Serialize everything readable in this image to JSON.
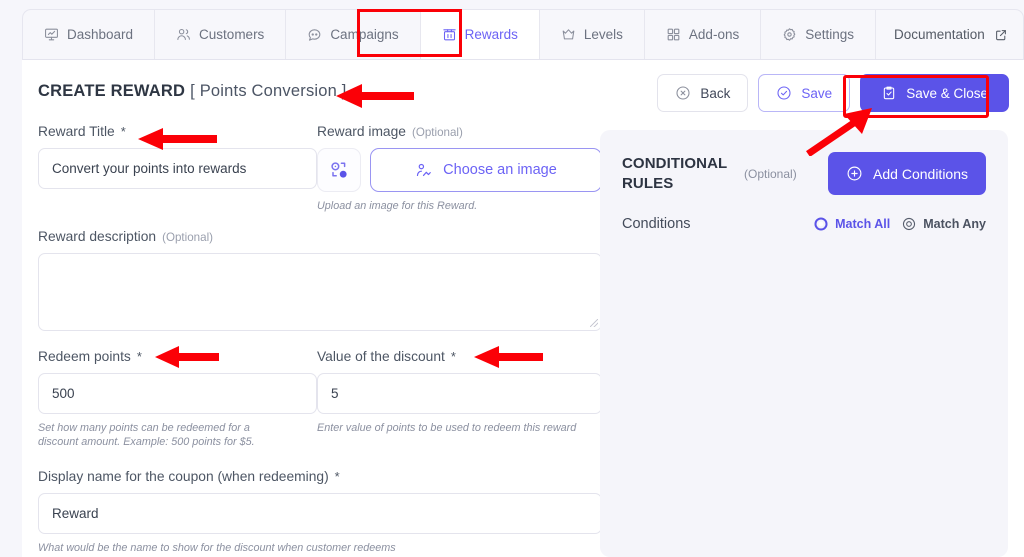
{
  "nav": {
    "tabs": [
      {
        "label": "Dashboard",
        "icon": "monitor-icon",
        "active": false
      },
      {
        "label": "Customers",
        "icon": "users-icon",
        "active": false
      },
      {
        "label": "Campaigns",
        "icon": "megaphone-icon",
        "active": false
      },
      {
        "label": "Rewards",
        "icon": "gift-icon",
        "active": true
      },
      {
        "label": "Levels",
        "icon": "crown-icon",
        "active": false
      },
      {
        "label": "Add-ons",
        "icon": "grid-icon",
        "active": false
      },
      {
        "label": "Settings",
        "icon": "gear-icon",
        "active": false
      }
    ],
    "documentation": {
      "label": "Documentation",
      "icon": "external-link-icon"
    }
  },
  "header": {
    "title": "CREATE REWARD",
    "variant": "[ Points Conversion ]"
  },
  "actions": {
    "back": {
      "label": "Back",
      "icon": "close-circle-icon"
    },
    "save": {
      "label": "Save",
      "icon": "check-circle-icon"
    },
    "save_close": {
      "label": "Save & Close",
      "icon": "clipboard-check-icon"
    }
  },
  "form": {
    "reward_title": {
      "label": "Reward Title",
      "required": "*",
      "value": "Convert your points into rewards",
      "placeholder": ""
    },
    "reward_image": {
      "label": "Reward image",
      "optional": "(Optional)",
      "button_label": "Choose an image",
      "button_icon": "image-upload-icon",
      "thumb_icon": "image-placeholder-icon",
      "hint": "Upload an image for this Reward."
    },
    "reward_description": {
      "label": "Reward description",
      "optional": "(Optional)",
      "value": "",
      "placeholder": ""
    },
    "redeem_points": {
      "label": "Redeem points",
      "required": "*",
      "value": "500",
      "hint": "Set how many points can be redeemed for a discount amount. Example: 500 points for $5."
    },
    "discount_value": {
      "label": "Value of the discount",
      "required": "*",
      "value": "5",
      "hint": "Enter value of points to be used to redeem this reward"
    },
    "coupon_display_name": {
      "label": "Display name for the coupon (when redeeming)",
      "required": "*",
      "value": "Reward",
      "hint": "What would be the name to show for the discount when customer redeems"
    }
  },
  "conditional_rules": {
    "title": "CONDITIONAL RULES",
    "title_line1": "CONDITIONAL",
    "title_line2": "RULES",
    "optional": "(Optional)",
    "add_button": {
      "label": "Add Conditions",
      "icon": "plus-circle-icon"
    },
    "conditions_label": "Conditions",
    "match_all": {
      "label": "Match All",
      "selected": true
    },
    "match_any": {
      "label": "Match Any",
      "selected": false
    }
  },
  "colors": {
    "accent": "#5b53e8",
    "accent_light": "#6c63f5",
    "annotation_red": "#fb0007",
    "page_bg": "#f6f6fb",
    "panel_bg": "#f5f5fa",
    "text": "#3a4250",
    "muted": "#8b90a0"
  }
}
